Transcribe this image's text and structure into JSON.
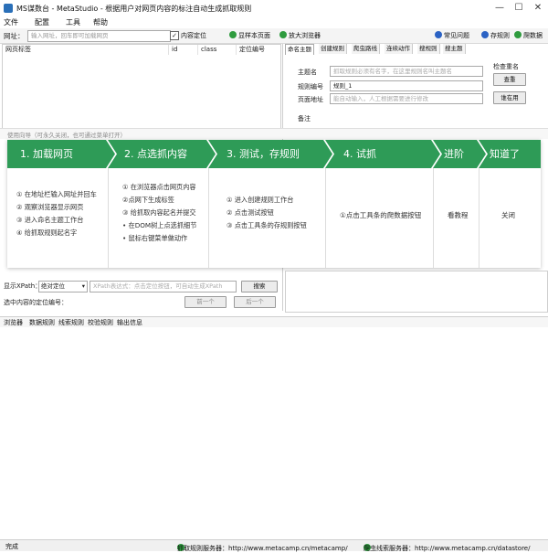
{
  "window": {
    "title": "MS谋数台 - MetaStudio - 根据用户对网页内容的标注自动生成抓取规则",
    "minimize": "—",
    "maximize": "☐",
    "close": "✕"
  },
  "menu": [
    "文件",
    "配置",
    "工具",
    "帮助"
  ],
  "toolbar": {
    "url_label": "网址：",
    "url_placeholder": "输入网址，回车即可加载网页",
    "content_locate": "内容定位",
    "save_sample": "显样本页面",
    "zoom_browser": "放大浏览器",
    "faq": "常见问题",
    "save_rule": "存规则",
    "crawl_data": "爬数据"
  },
  "left_table": {
    "columns": [
      "网页标签",
      "id",
      "class",
      "定位编号"
    ]
  },
  "right_panel": {
    "tabs": [
      "命名主题",
      "创建规则",
      "爬虫路线",
      "连续动作",
      "搜规则",
      "搜主题"
    ],
    "theme_label": "主题名",
    "theme_placeholder": "抓取规则必须有名字，在这里规则名叫主题名",
    "check_theme_label": "检查重名",
    "check_button": "查重",
    "rule_no_label": "规则编号",
    "rule_no_value": "规则_1",
    "in_use_button": "谁在用",
    "page_addr_label": "页面地址",
    "page_addr_placeholder": "能自动输入，人工根据需要进行修改",
    "remark_label": "备注"
  },
  "guide_hint": "使用向导（可永久关闭，也可通过菜单打开）",
  "guide": {
    "steps": [
      {
        "title": "1. 加载网页",
        "lines": [
          "① 在地址栏输入网址并回车",
          "② 观察浏览器显示网页",
          "③ 进入命名主题工作台",
          "④ 给抓取规则起名字"
        ]
      },
      {
        "title": "2. 点选抓内容",
        "lines": [
          "① 在浏览器点击网页内容",
          "②点网下生成标签",
          "③ 给抓取内容起名并提交",
          "• 在DOM树上点选抓细节",
          "• 鼠标右键菜单做动作"
        ]
      },
      {
        "title": "3. 测试，存规则",
        "lines": [
          "① 进入创建规则工作台",
          "② 点击测试按钮",
          "③ 点击工具条的存规则按钮"
        ]
      },
      {
        "title": "4. 试抓",
        "lines": [
          "①点击工具条的爬数据按钮"
        ]
      },
      {
        "title": "进阶",
        "lines": [
          "看教程"
        ]
      },
      {
        "title": "知道了",
        "lines": [
          "关闭"
        ]
      }
    ]
  },
  "xpath": {
    "label": "显示XPath：",
    "select_value": "绝对定位",
    "input_placeholder": "XPath表达式：点击定位按钮，可自动生成XPath",
    "search_button": "搜索",
    "locate_label": "选中内容的定位编号：",
    "prev_button": "前一个",
    "next_button": "后一个"
  },
  "bottom_tabs": [
    "浏览器",
    "数据规则",
    "线索规则",
    "校验规则",
    "输出信息"
  ],
  "status": {
    "done": "完成",
    "rule_server": "抓取规则服务器：http://www.metacamp.cn/metacamp/",
    "clue_server": "爬虫线索服务器：http://www.metacamp.cn/datastore/"
  }
}
